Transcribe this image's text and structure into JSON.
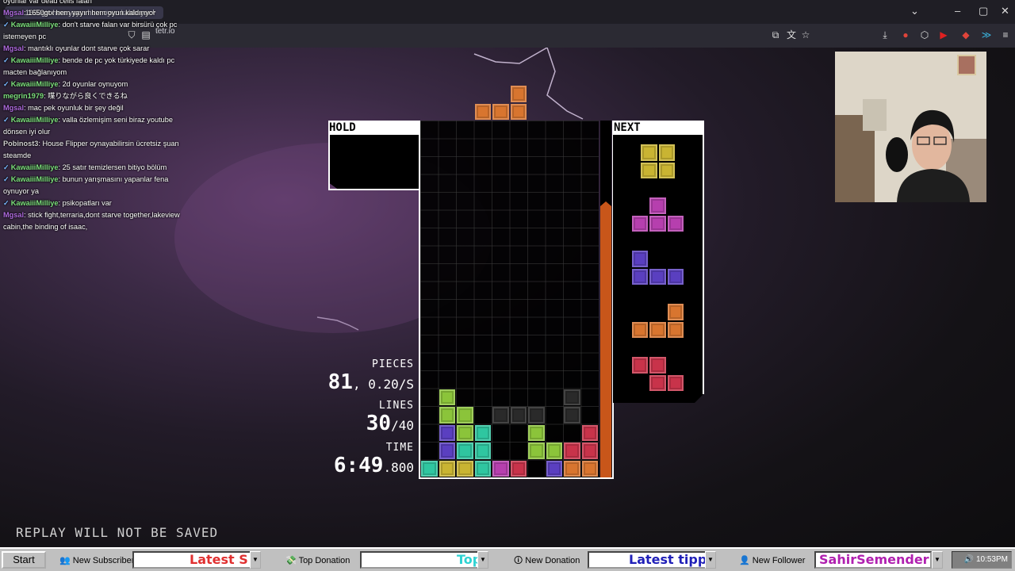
{
  "browser": {
    "tab_partial": "1650gtx hem yayın hem oyun kaldırıyor",
    "address": "tetr.io",
    "new_tab": "+"
  },
  "chat": [
    {
      "user": "",
      "text": "oyunlar var dead cells falan",
      "color": "#ffffff",
      "badge": false
    },
    {
      "user": "Mgsal",
      "text": "1650gtx hem yayın hem oyun kaldırıyor",
      "color": "#b06be0",
      "badge": false
    },
    {
      "user": "KawaiiiMilliye",
      "text": "don't starve falan var birsürü çok pc istemeyen pc",
      "color": "#7de07d",
      "badge": true
    },
    {
      "user": "Mgsal",
      "text": "mantıklı oyunlar dont starve çok sarar",
      "color": "#b06be0",
      "badge": false
    },
    {
      "user": "KawaiiiMilliye",
      "text": "bende de pc yok türkiyede kaldı pc macten bağlanıyom",
      "color": "#7de07d",
      "badge": true
    },
    {
      "user": "KawaiiiMilliye",
      "text": "2d oyunlar oynuyom",
      "color": "#7de07d",
      "badge": true
    },
    {
      "user": "megrin1979",
      "text": "喋りながら良くできるね",
      "color": "#7de07d",
      "badge": false
    },
    {
      "user": "Mgsal",
      "text": "mac pek oyunluk bir şey değil",
      "color": "#b06be0",
      "badge": false
    },
    {
      "user": "KawaiiiMilliye",
      "text": "valla özlemişim seni biraz youtube dönsen iyi olur",
      "color": "#7de07d",
      "badge": true
    },
    {
      "user": "Pobinost3",
      "text": "House Flipper oynayabilirsin ücretsiz şuan steamde",
      "color": "#d0d0d0",
      "badge": false
    },
    {
      "user": "KawaiiiMilliye",
      "text": "25 satır temizlersen bitiyo bölüm",
      "color": "#7de07d",
      "badge": true
    },
    {
      "user": "KawaiiiMilliye",
      "text": "bunun yarışmasını yapanlar fena oynuyor ya",
      "color": "#7de07d",
      "badge": true
    },
    {
      "user": "KawaiiiMilliye",
      "text": "psikopatları var",
      "color": "#7de07d",
      "badge": true
    },
    {
      "user": "Mgsal",
      "text": "stick fight,terraria,dont starve together,lakeview cabin,the binding of isaac,",
      "color": "#b06be0",
      "badge": false
    }
  ],
  "game": {
    "hold_label": "HOLD",
    "next_label": "NEXT",
    "pieces_label": "PIECES",
    "pieces_value": "81",
    "pieces_rate": "0.20/S",
    "lines_label": "LINES",
    "lines_value": "30",
    "lines_goal": "/40",
    "time_label": "TIME",
    "time_main": "6:49",
    "time_ms": ".800",
    "replay_notice": "REPLAY WILL NOT BE SAVED",
    "colors": {
      "Z": "#c8334a",
      "S": "#8bc43a",
      "L": "#d8752f",
      "J": "#5a3fc0",
      "I": "#2fc6a0",
      "O": "#c9b432",
      "T": "#b63fae",
      "G": "#2a2a2a"
    },
    "board_rows": [
      "..........",
      "..........",
      "..........",
      "..........",
      "..........",
      "..........",
      "..........",
      "..........",
      "..........",
      "..........",
      "..........",
      "..........",
      "..........",
      "..........",
      "..........",
      ".S......G.",
      ".SS.GGG.G.",
      ".JSI..S..Z",
      ".JII..SSZZ",
      "IOOITZ.JLL"
    ],
    "falling_piece": {
      "type": "L",
      "cells": [
        [
          3,
          0
        ],
        [
          4,
          0
        ],
        [
          5,
          0
        ],
        [
          5,
          -1
        ]
      ]
    },
    "next_queue": [
      "O",
      "T",
      "J",
      "L",
      "Z"
    ]
  },
  "taskbar": {
    "start": "Start",
    "new_subscriber": "New Subscriber",
    "latest_sub_ticker": "Latest S",
    "top_donation": "Top Donation",
    "top_ticker": "Top",
    "new_donation": "New Donation",
    "latest_tipper": "Latest tippe",
    "new_follower": "New Follower",
    "follower_name": "SahirSemender",
    "clock": "10:53PM"
  }
}
